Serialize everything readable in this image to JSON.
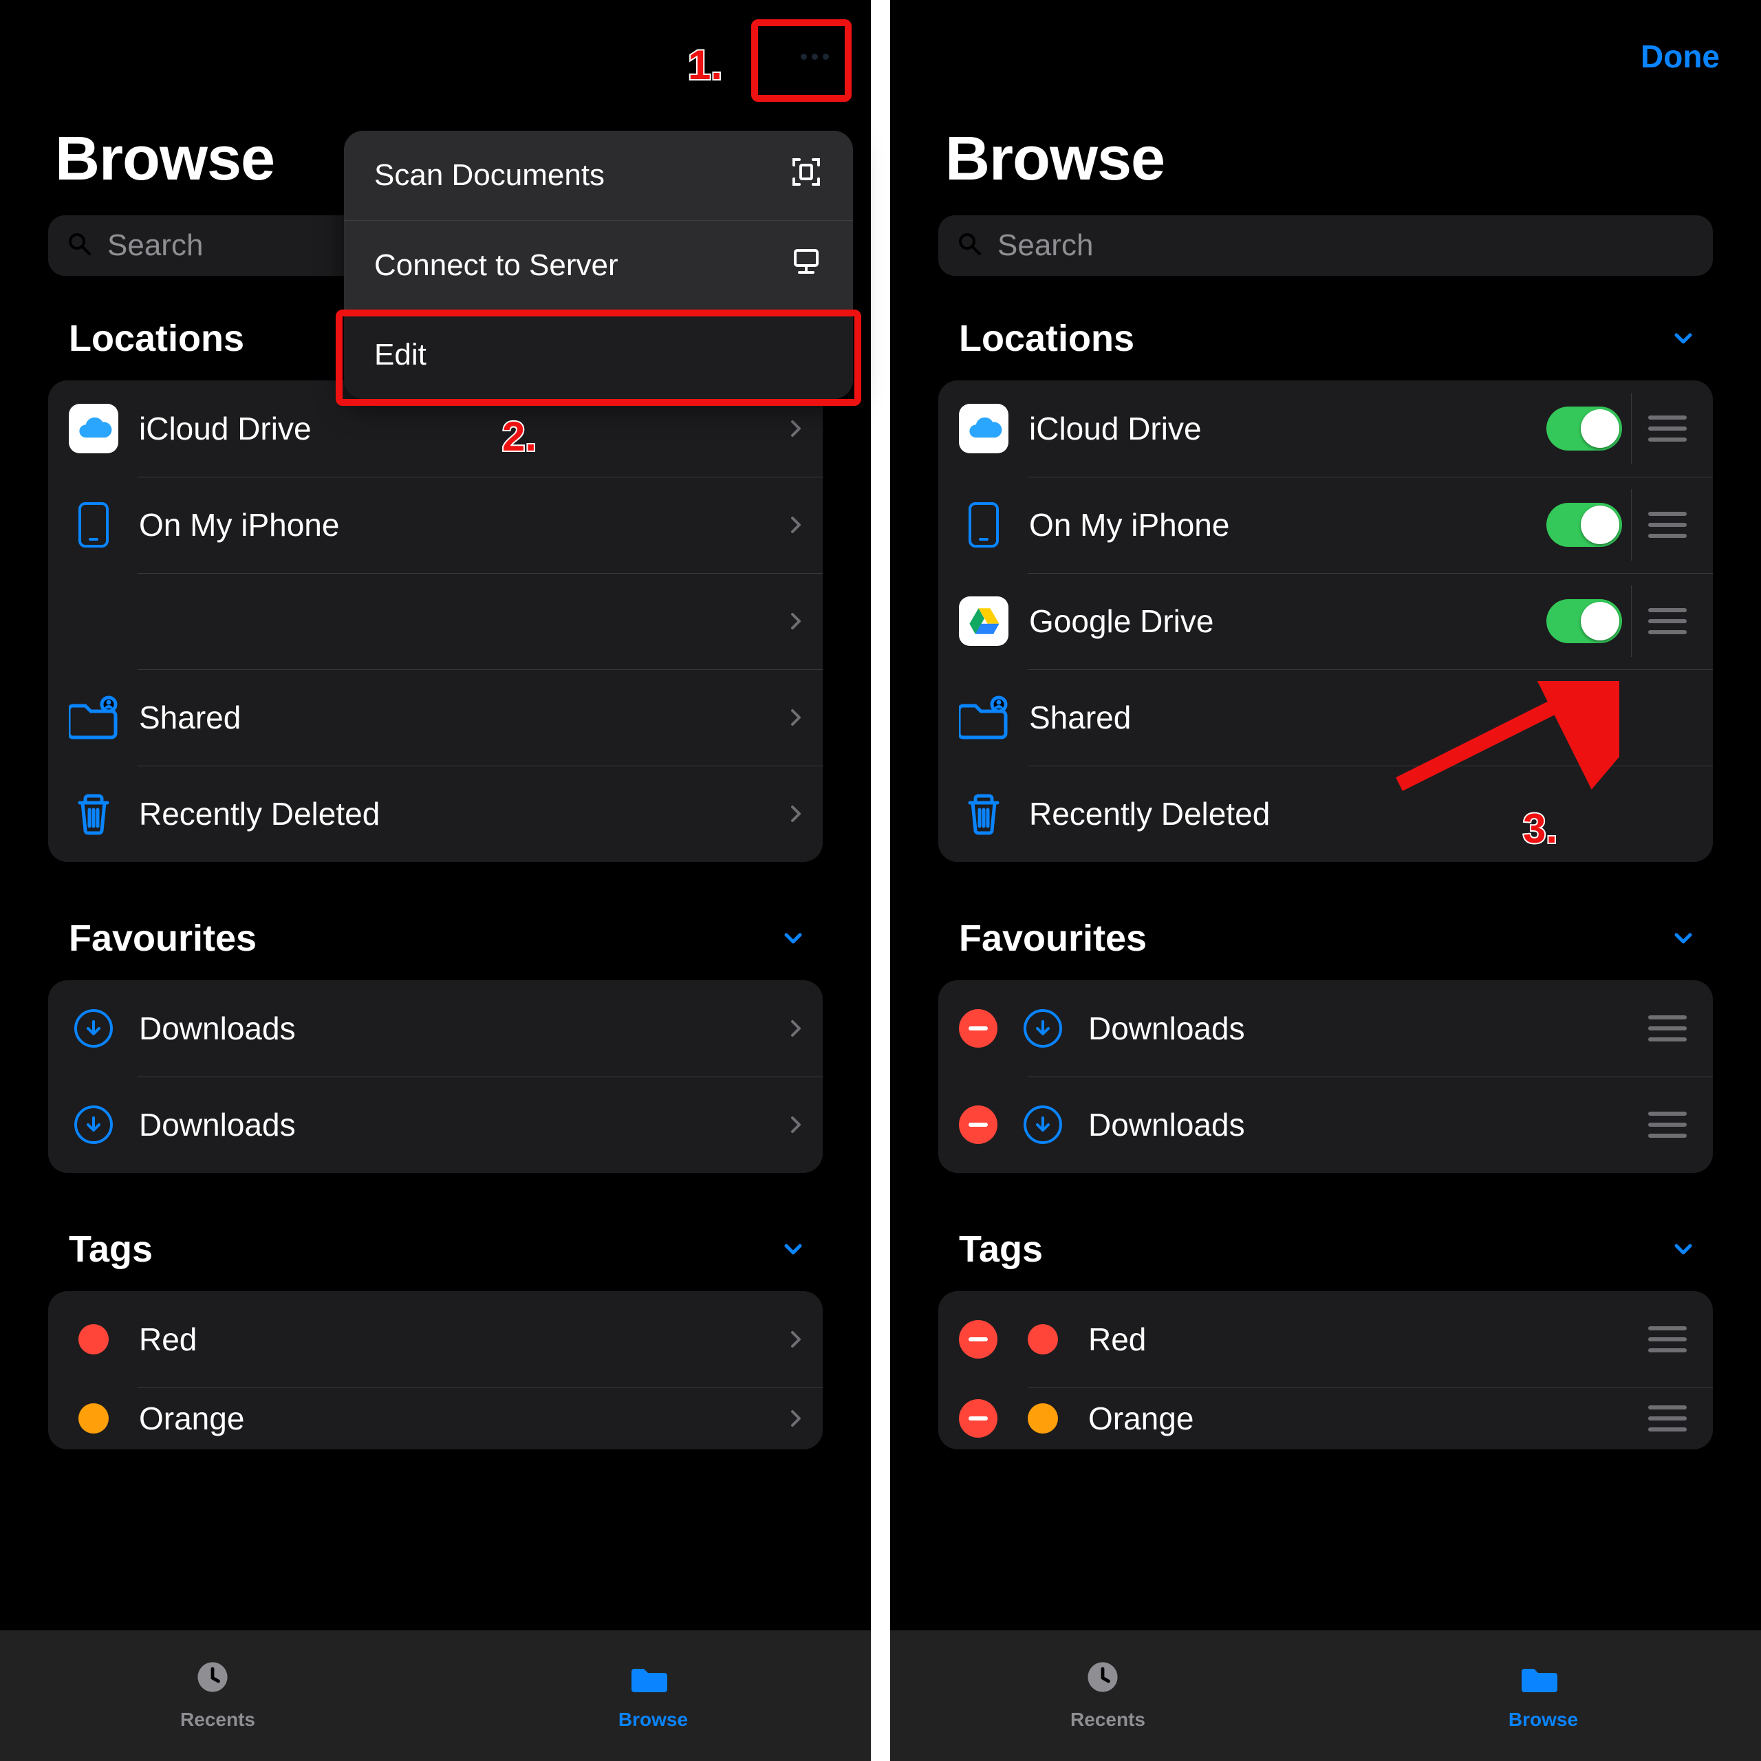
{
  "colors": {
    "accent": "#0a84ff",
    "green": "#34c759",
    "red": "#ff453a",
    "annotation": "#ee1111"
  },
  "annotations": {
    "n1": "1.",
    "n2": "2.",
    "n3": "3."
  },
  "left": {
    "page_title": "Browse",
    "search_placeholder": "Search",
    "menu": {
      "scan": "Scan Documents",
      "connect": "Connect to Server",
      "edit": "Edit"
    },
    "sections": {
      "locations": {
        "header": "Locations",
        "items": [
          {
            "label": "iCloud Drive"
          },
          {
            "label": "On My iPhone"
          },
          {
            "label": ""
          },
          {
            "label": "Shared"
          },
          {
            "label": "Recently Deleted"
          }
        ]
      },
      "favourites": {
        "header": "Favourites",
        "items": [
          {
            "label": "Downloads"
          },
          {
            "label": "Downloads"
          }
        ]
      },
      "tags": {
        "header": "Tags",
        "items": [
          {
            "label": "Red",
            "color": "#ff453a"
          },
          {
            "label": "Orange",
            "color": "#ff9f0a"
          }
        ]
      }
    },
    "tabs": {
      "recents": "Recents",
      "browse": "Browse"
    }
  },
  "right": {
    "page_title": "Browse",
    "done": "Done",
    "search_placeholder": "Search",
    "sections": {
      "locations": {
        "header": "Locations",
        "items": [
          {
            "label": "iCloud Drive",
            "toggle": true
          },
          {
            "label": "On My iPhone",
            "toggle": true
          },
          {
            "label": "Google Drive",
            "toggle": true
          },
          {
            "label": "Shared"
          },
          {
            "label": "Recently Deleted"
          }
        ]
      },
      "favourites": {
        "header": "Favourites",
        "items": [
          {
            "label": "Downloads"
          },
          {
            "label": "Downloads"
          }
        ]
      },
      "tags": {
        "header": "Tags",
        "items": [
          {
            "label": "Red",
            "color": "#ff453a"
          },
          {
            "label": "Orange",
            "color": "#ff9f0a"
          }
        ]
      }
    },
    "tabs": {
      "recents": "Recents",
      "browse": "Browse"
    }
  }
}
